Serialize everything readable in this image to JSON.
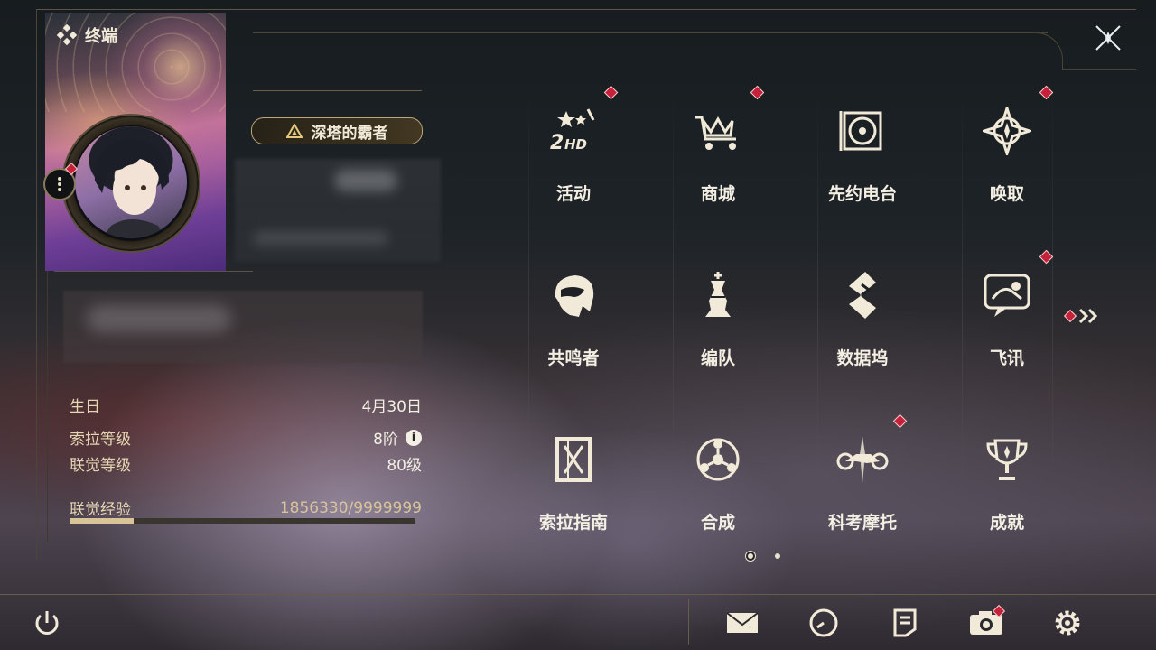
{
  "header": {
    "title": "终端"
  },
  "profile": {
    "title_badge": "深塔的霸者",
    "birthday_label": "生日",
    "birthday_value": "4月30日",
    "sola_label": "索拉等级",
    "sola_value": "8阶",
    "union_label": "联觉等级",
    "union_value": "80级",
    "exp_label": "联觉经验",
    "exp_value": "1856330/9999999",
    "exp_progress": 0.186
  },
  "menu": [
    {
      "label": "活动",
      "icon": "events-2hd-icon",
      "badge": true
    },
    {
      "label": "商城",
      "icon": "shop-crown-cart-icon",
      "badge": true
    },
    {
      "label": "先约电台",
      "icon": "radio-vinyl-icon",
      "badge": false
    },
    {
      "label": "唤取",
      "icon": "convene-compass-icon",
      "badge": true
    },
    {
      "label": "共鸣者",
      "icon": "resonator-head-icon",
      "badge": false
    },
    {
      "label": "编队",
      "icon": "team-chess-icon",
      "badge": false
    },
    {
      "label": "数据坞",
      "icon": "data-bank-icon",
      "badge": false
    },
    {
      "label": "飞讯",
      "icon": "messages-chat-icon",
      "badge": true
    },
    {
      "label": "索拉指南",
      "icon": "guidebook-icon",
      "badge": false
    },
    {
      "label": "合成",
      "icon": "synthesis-icon",
      "badge": false
    },
    {
      "label": "科考摩托",
      "icon": "motorcycle-icon",
      "badge": true
    },
    {
      "label": "成就",
      "icon": "achievement-trophy-icon",
      "badge": false
    }
  ],
  "pager": {
    "current": 1,
    "total": 2
  },
  "colors": {
    "accent": "#d9c49a",
    "badge": "#c5213a",
    "text": "#f4efe3"
  }
}
